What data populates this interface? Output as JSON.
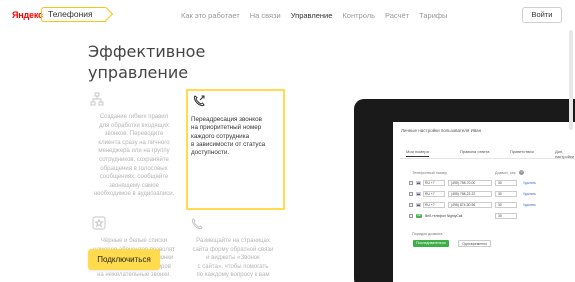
{
  "header": {
    "logo": "Яндекс",
    "product": "Телефония",
    "nav": [
      {
        "label": "Как это работает",
        "active": false
      },
      {
        "label": "На связи",
        "active": false
      },
      {
        "label": "Управление",
        "active": true
      },
      {
        "label": "Контроль",
        "active": false
      },
      {
        "label": "Расчёт",
        "active": false
      },
      {
        "label": "Тарифы",
        "active": false
      }
    ],
    "login": "Войти"
  },
  "heading": {
    "line1": "Эффективное",
    "line2": "управление"
  },
  "features": {
    "routing": {
      "lines": [
        "Создание гибких правил",
        "для обработки входящих",
        "звонков. Переводите",
        "клиента сразу на личного",
        "менеджера или на группу",
        "сотрудников, сохраняйте",
        "обращения в голосовых",
        "сообщениях, сообщайте",
        "звонящему самое",
        "необходимое в аудиозаписи."
      ]
    },
    "forwarding": {
      "lines": [
        "Переадресация звонков",
        "на приоритетный номер",
        "каждого сотрудника",
        "в зависимости от статуса",
        "доступности."
      ]
    },
    "lists": {
      "lines": [
        "Чёрные и белые списки",
        "номеров абонентов позволят",
        "отключить входящие звонки",
        "с нежелательных номеров",
        "на нежелательные звонки."
      ]
    },
    "widget": {
      "lines": [
        "Размещайте на страницах",
        "сайта форму обратной связи",
        "и виджеты «Звонок",
        "с сайта», чтобы помогать",
        "по каждому вопросу к вам"
      ]
    }
  },
  "connect_button": "Подключиться",
  "app": {
    "title": "Личные настройки пользователя Иван",
    "tabs": [
      "Мои номера",
      "Правила ответа",
      "Приветствия",
      "Доп. настройки"
    ],
    "phone_label": "Телефонный номер",
    "delay_label": "Дозвон, сек.",
    "rows": [
      {
        "code": "RU +7",
        "number": "(495) 758-70-00",
        "delay": "30",
        "action": "Удалить"
      },
      {
        "code": "RU +7",
        "number": "(495) 758-22-22",
        "delay": "30",
        "action": "Удалить"
      },
      {
        "code": "RU +7",
        "number": "(495) 874-30-96",
        "delay": "30",
        "action": "Удалить"
      },
      {
        "badge": "SIP",
        "number": "Веб-телефон NightyCall",
        "delay": "30",
        "action": ""
      }
    ],
    "order_label": "Порядок дозвона",
    "order_primary": "Последовательно",
    "order_secondary": "Одновременно"
  },
  "colors": {
    "accent": "#ffdb4d",
    "logo_red": "#ff0000",
    "green": "#3fae49",
    "link": "#3a6bc9"
  }
}
